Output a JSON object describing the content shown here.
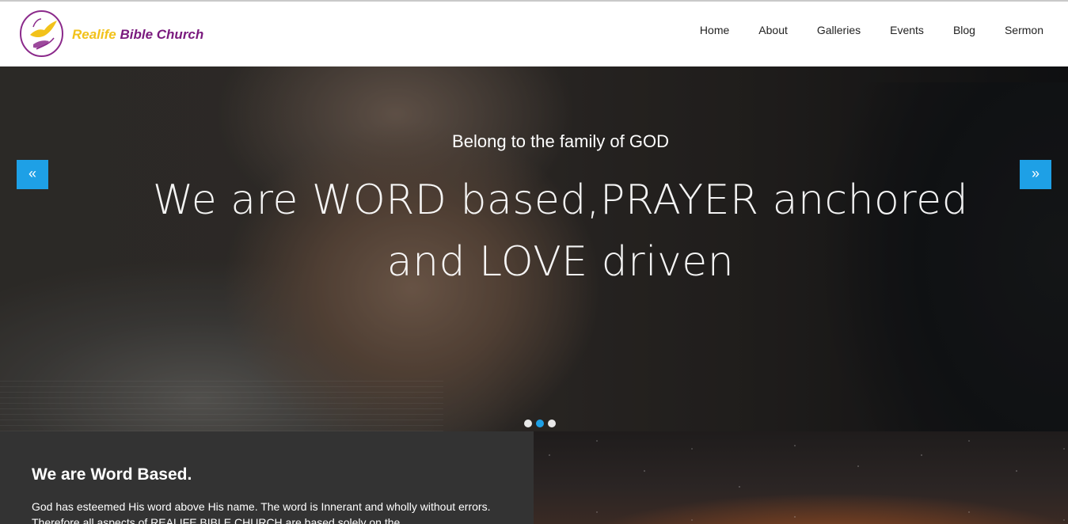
{
  "brand": {
    "name_part1": "Realife",
    "name_part2": "Bible Church"
  },
  "nav": {
    "items": [
      {
        "label": "Home"
      },
      {
        "label": "About"
      },
      {
        "label": "Galleries"
      },
      {
        "label": "Events"
      },
      {
        "label": "Blog"
      },
      {
        "label": "Sermon"
      }
    ]
  },
  "hero": {
    "subtitle": "Belong to the family of GOD",
    "title_line1": "We are WORD based,PRAYER anchored",
    "title_line2": "and LOVE driven",
    "prev_icon": "«",
    "next_icon": "»",
    "slides": 3,
    "active_slide": 2,
    "accent_color": "#1ea0e6"
  },
  "feature": {
    "heading": "We are Word Based.",
    "text": "God has esteemed His word above His name. The word is Innerant and wholly without errors. Therefore all aspects of REALIFE BIBLE CHURCH are based solely on the"
  },
  "colors": {
    "brand_yellow": "#f2c21a",
    "brand_purple": "#7a1a7e",
    "feature_bg": "#333333"
  }
}
